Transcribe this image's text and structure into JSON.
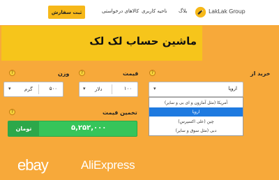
{
  "header": {
    "order_button": "ثبت سفارش",
    "nav": [
      "کالاهای درخواستی",
      "ناحیه کاربری",
      "بلاگ"
    ],
    "brand": "LakLak Group"
  },
  "title": "ماشین حساب لک لک",
  "form": {
    "buy_from_label": "خرید از",
    "price_label": "قیمت",
    "weight_label": "وزن",
    "estimate_label": "تخمین قیمت",
    "help_glyph": "?",
    "buy_from_value": "اروپا",
    "price_value": "۱۰۰",
    "price_unit": "دلار",
    "weight_value": "۵۰۰",
    "weight_unit": "گرم"
  },
  "result": {
    "currency": "تومان",
    "amount": "۵,۲۵۲,۰۰۰"
  },
  "dropdown": {
    "options": [
      "آمریکا (مثل آمازون و ای بی و سایر)",
      "اروپا",
      "چین (علی اکسپرس)",
      "دبی (مثل سوق و سایر)"
    ],
    "selected_index": 1
  },
  "brands": [
    "ebay",
    "AliExpress"
  ],
  "colors": {
    "background": "#f7a93a",
    "title_band": "#f6c51b",
    "order_button": "#f6b819",
    "result_green": "#36c55a",
    "dropdown_selected": "#1e7ae0"
  }
}
